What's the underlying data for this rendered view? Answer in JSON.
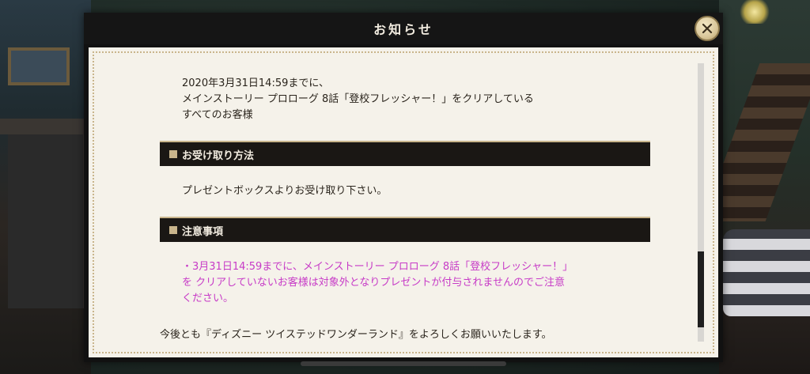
{
  "dialog": {
    "title": "お知らせ",
    "close_icon": "close-icon"
  },
  "intro": {
    "line1": "2020年3月31日14:59までに、",
    "line2": "メインストーリー プロローグ 8話「登校フレッシャー！」をクリアしている",
    "line3": "すべてのお客様"
  },
  "sections": [
    {
      "heading": "お受け取り方法",
      "body": "プレゼントボックスよりお受け取り下さい。"
    },
    {
      "heading": "注意事項",
      "notice_line1": "・3月31日14:59までに、メインストーリー プロローグ 8話「登校フレッシャー！」",
      "notice_line2": "を クリアしていないお客様は対象外となりプレゼントが付与されませんのでご注意",
      "notice_line3": "ください。"
    }
  ],
  "footer": {
    "text": "今後とも『ディズニー ツイステッドワンダーランド』をよろしくお願いいたします。"
  },
  "colors": {
    "notice": "#c73bc7",
    "section_bg": "#1a1714",
    "accent_gold": "#c9b58c",
    "paper": "#f5f2ea"
  }
}
